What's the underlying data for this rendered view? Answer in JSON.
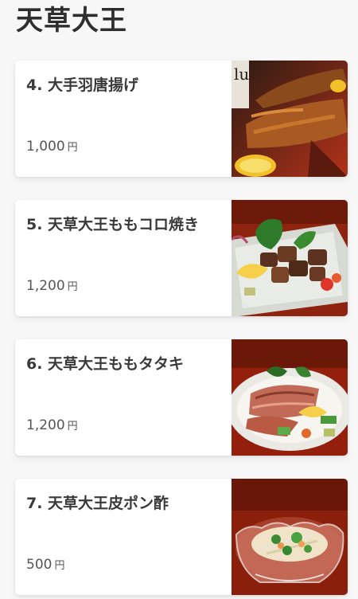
{
  "page": {
    "title": "天草大王"
  },
  "menu": [
    {
      "name": "4. 大手羽唐揚げ",
      "price": "1,000",
      "unit": "円",
      "image": "fried-chicken-wings-photo"
    },
    {
      "name": "5. 天草大王ももコロ焼き",
      "price": "1,200",
      "unit": "円",
      "image": "grilled-chicken-thigh-cubes-photo"
    },
    {
      "name": "6. 天草大王ももタタキ",
      "price": "1,200",
      "unit": "円",
      "image": "seared-chicken-tataki-photo"
    },
    {
      "name": "7. 天草大王皮ポン酢",
      "price": "500",
      "unit": "円",
      "image": "chicken-skin-ponzu-glass-bowl-photo"
    }
  ],
  "colors": {
    "background": "#f7f7f7",
    "card": "#ffffff",
    "text": "#3a3a3a",
    "wood": "#8e2410"
  }
}
